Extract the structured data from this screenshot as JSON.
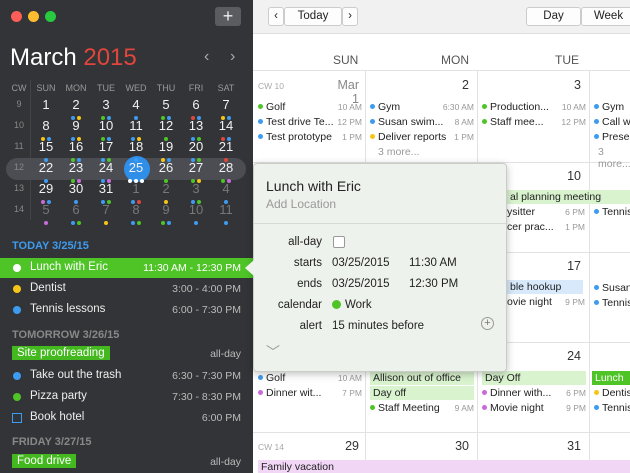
{
  "sidebar": {
    "month": "March",
    "year": "2015",
    "add_label": "+",
    "prev_label": "‹",
    "next_label": "›",
    "weekday_headers": [
      "CW",
      "SUN",
      "MON",
      "TUE",
      "WED",
      "THU",
      "FRI",
      "SAT"
    ],
    "weeks": [
      {
        "cw": "9",
        "days": [
          "1",
          "2",
          "3",
          "4",
          "5",
          "6",
          "7"
        ]
      },
      {
        "cw": "10",
        "days": [
          "8",
          "9",
          "10",
          "11",
          "12",
          "13",
          "14"
        ]
      },
      {
        "cw": "11",
        "days": [
          "15",
          "16",
          "17",
          "18",
          "19",
          "20",
          "21"
        ]
      },
      {
        "cw": "12",
        "days": [
          "22",
          "23",
          "24",
          "25",
          "26",
          "27",
          "28"
        ]
      },
      {
        "cw": "13",
        "days": [
          "29",
          "30",
          "31",
          "1",
          "2",
          "3",
          "4"
        ]
      },
      {
        "cw": "14",
        "days": [
          "5",
          "6",
          "7",
          "8",
          "9",
          "10",
          "11"
        ]
      }
    ],
    "sections": [
      {
        "header": "TODAY 3/25/15",
        "events": [
          {
            "title": "Lunch with Eric",
            "time": "11:30 AM - 12:30 PM",
            "color": "#ffffff",
            "selected": true
          },
          {
            "title": "Dentist",
            "time": "3:00 - 4:00 PM",
            "color": "#f5c518"
          },
          {
            "title": "Tennis lessons",
            "time": "6:00 - 7:30 PM",
            "color": "#3d9bf0"
          }
        ]
      },
      {
        "header": "TOMORROW 3/26/15",
        "events": [
          {
            "title": "Site proofreading",
            "time": "all-day",
            "pill": true
          },
          {
            "title": "Take out the trash",
            "time": "6:30 - 7:30 PM",
            "color": "#3d9bf0"
          },
          {
            "title": "Pizza party",
            "time": "7:30 - 8:30 PM",
            "color": "#4ec427"
          },
          {
            "title": "Book hotel",
            "time": "6:00 PM",
            "task": true
          }
        ]
      },
      {
        "header": "FRIDAY 3/27/15",
        "events": [
          {
            "title": "Food drive",
            "time": "all-day",
            "pill": true
          }
        ]
      }
    ]
  },
  "toolbar": {
    "prev": "‹",
    "today": "Today",
    "next": "›",
    "day": "Day",
    "week": "Week"
  },
  "columns": [
    "SUN",
    "MON",
    "TUE"
  ],
  "rows": [
    {
      "cw": "CW 10",
      "nums": [
        "Mar 1",
        "2",
        "3"
      ]
    },
    {
      "cw": "",
      "nums": [
        "",
        "",
        "10"
      ]
    },
    {
      "cw": "",
      "nums": [
        "",
        "",
        "17"
      ]
    },
    {
      "cw": "",
      "nums": [
        "",
        "",
        "24"
      ]
    },
    {
      "cw": "CW 14",
      "nums": [
        "29",
        "30",
        "31"
      ]
    }
  ],
  "events": {
    "r1c0": [
      {
        "t": "Golf",
        "tm": "10 AM",
        "c": "#4ec427"
      },
      {
        "t": "Test drive Te...",
        "tm": "12 PM",
        "c": "#3d9bf0"
      },
      {
        "t": "Test prototype",
        "tm": "1 PM",
        "c": "#3d9bf0"
      }
    ],
    "r1c1": [
      {
        "t": "Gym",
        "tm": "6:30 AM",
        "c": "#3d9bf0"
      },
      {
        "t": "Susan swim...",
        "tm": "8 AM",
        "c": "#3d9bf0"
      },
      {
        "t": "Deliver reports",
        "tm": "1 PM",
        "c": "#f5c518"
      }
    ],
    "r1c2": [
      {
        "t": "Production...",
        "tm": "10 AM",
        "c": "#4ec427"
      },
      {
        "t": "Staff mee...",
        "tm": "12 PM",
        "c": "#4ec427"
      }
    ],
    "r1c3": [
      {
        "t": "Gym",
        "c": "#3d9bf0"
      },
      {
        "t": "Call w",
        "c": "#3d9bf0"
      },
      {
        "t": "Prese",
        "c": "#3d9bf0"
      }
    ],
    "more1": "3 more...",
    "more2": "3 more...",
    "r2bar": "al planning meeting",
    "r2c2": [
      {
        "t": "ysitter",
        "tm": "6 PM"
      },
      {
        "t": "cer prac...",
        "tm": "1 PM"
      }
    ],
    "r2c3": [
      {
        "t": "Tennis",
        "c": "#3d9bf0"
      }
    ],
    "r3bar": "ble hookup",
    "r3c2": [
      {
        "t": "ovie night",
        "tm": "9 PM"
      }
    ],
    "r3c3": [
      {
        "t": "Susan",
        "c": "#3d9bf0"
      },
      {
        "t": "Tennis",
        "c": "#3d9bf0"
      }
    ],
    "r4c0": [
      {
        "t": "Golf",
        "tm": "10 AM",
        "c": "#3d9bf0"
      },
      {
        "t": "Dinner wit...",
        "tm": "7 PM",
        "c": "#c86bd8"
      }
    ],
    "r4bars": [
      "Allison out of office",
      "Day off"
    ],
    "r4c1": [
      {
        "t": "Staff Meeting",
        "tm": "9 AM",
        "c": "#4ec427"
      }
    ],
    "r4dayoff": "Day Off",
    "r4c2": [
      {
        "t": "Dinner with...",
        "tm": "6 PM",
        "c": "#c86bd8"
      },
      {
        "t": "Movie night",
        "tm": "9 PM",
        "c": "#c86bd8"
      }
    ],
    "r4c3": [
      {
        "t": "Lunch"
      },
      {
        "t": "Dentis",
        "c": "#f5c518"
      },
      {
        "t": "Tennis",
        "c": "#3d9bf0"
      }
    ],
    "r5bar": "Family vacation"
  },
  "popover": {
    "title": "Lunch with Eric",
    "location_placeholder": "Add Location",
    "allday_label": "all-day",
    "starts_label": "starts",
    "starts_date": "03/25/2015",
    "starts_time": "11:30 AM",
    "ends_label": "ends",
    "ends_date": "03/25/2015",
    "ends_time": "12:30 PM",
    "calendar_label": "calendar",
    "calendar_value": "Work",
    "calendar_color": "#4ec427",
    "alert_label": "alert",
    "alert_value": "15 minutes before",
    "add_label": "+",
    "expand_label": "﹀"
  }
}
